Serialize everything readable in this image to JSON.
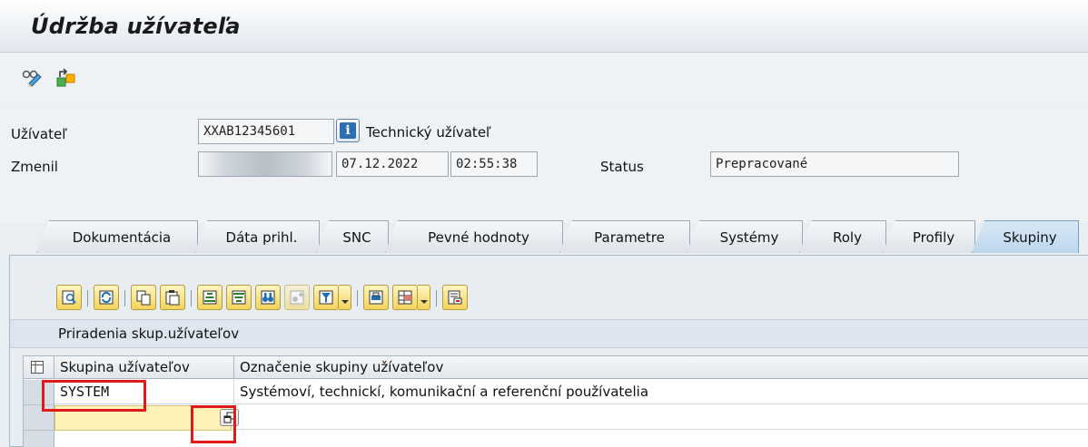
{
  "window": {
    "title": "Údržba užívateľa"
  },
  "app_toolbar": {
    "icons": [
      "display-change-icon",
      "other-object-icon"
    ]
  },
  "header": {
    "user_label": "Užívateľ",
    "user_value": "XXAB12345601",
    "user_type": "Technický užívateľ",
    "changed_label": "Zmenil",
    "changed_date": "07.12.2022",
    "changed_time": "02:55:38",
    "status_label": "Status",
    "status_value": "Prepracované"
  },
  "tabs": [
    {
      "label": "Dokumentácia"
    },
    {
      "label": "Dáta prihl."
    },
    {
      "label": "SNC"
    },
    {
      "label": "Pevné hodnoty"
    },
    {
      "label": "Parametre"
    },
    {
      "label": "Systémy"
    },
    {
      "label": "Roly"
    },
    {
      "label": "Profily"
    },
    {
      "label": "Skupiny"
    }
  ],
  "active_tab": "Skupiny",
  "grid": {
    "title": "Priradenia skup.užívateľov",
    "columns": [
      "Skupina užívateľov",
      "Označenie skupiny užívateľov"
    ],
    "rows": [
      {
        "group": "SYSTEM",
        "description": "Systémoví, technickí, komunikační a referenční používatelia"
      },
      {
        "group": "",
        "description": ""
      }
    ]
  },
  "colors": {
    "highlight": "#e01a1a",
    "edit_cell": "#fff1b8",
    "active_tab": "#bdd7ee"
  }
}
